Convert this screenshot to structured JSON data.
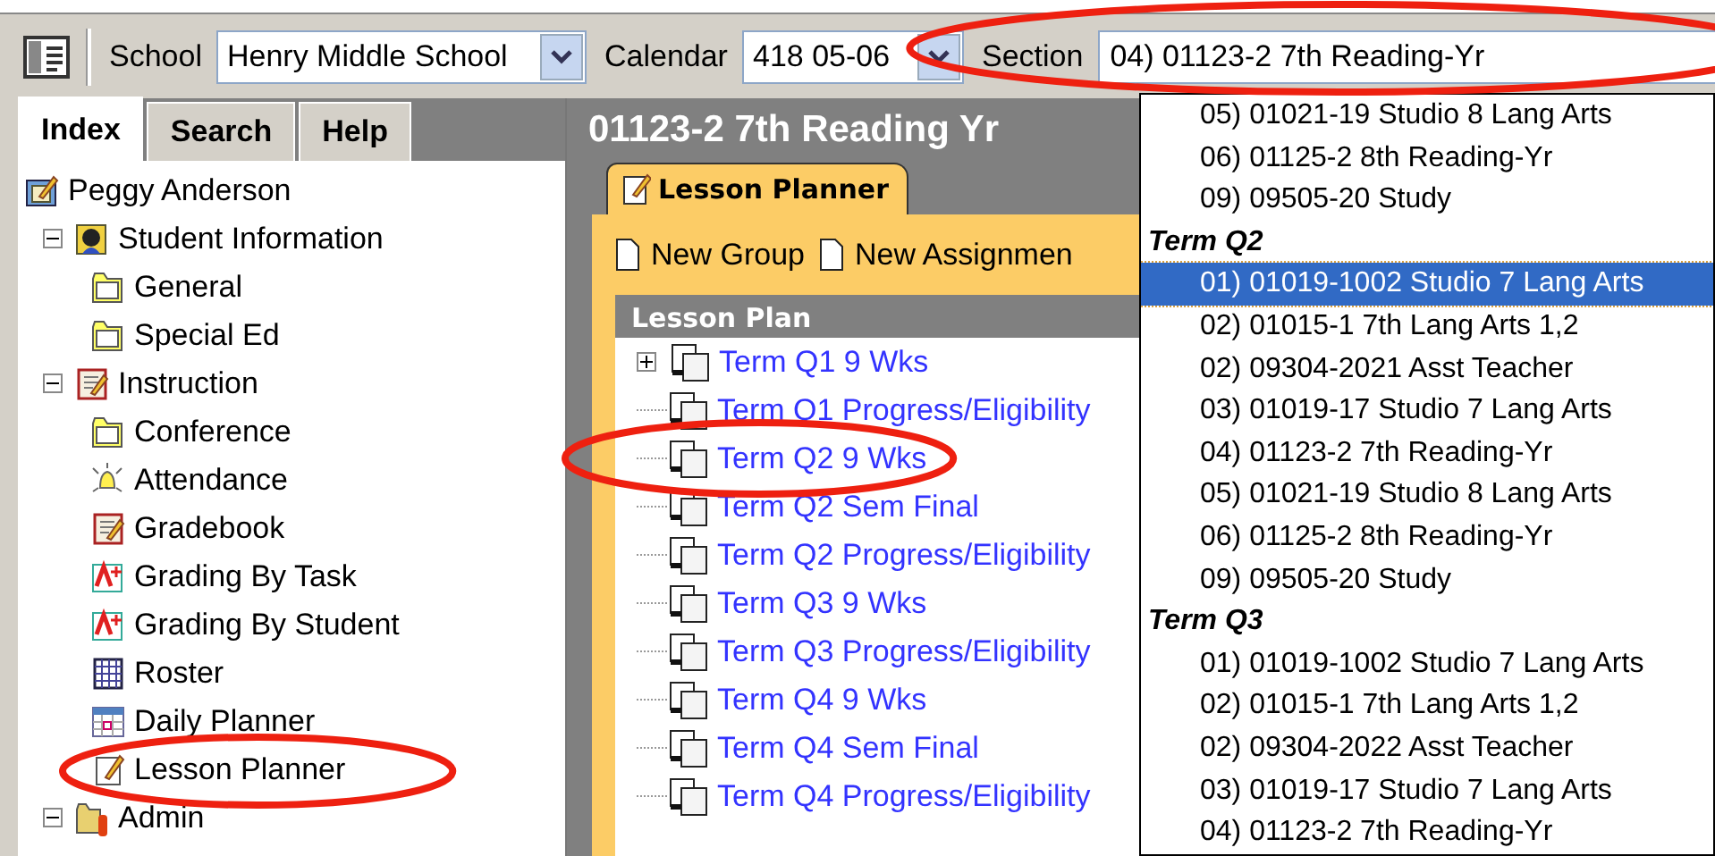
{
  "toolbar": {
    "school_label": "School",
    "school": "Henry Middle School",
    "calendar_label": "Calendar",
    "calendar": "418 05-06",
    "section_label": "Section",
    "section": "04) 01123-2 7th Reading-Yr",
    "section_circled": true
  },
  "sidebar": {
    "tabs": [
      {
        "label": "Index",
        "selected": true
      },
      {
        "label": "Search",
        "selected": false
      },
      {
        "label": "Help",
        "selected": false
      }
    ],
    "tree": [
      {
        "label": "Peggy Anderson",
        "kind": "person",
        "children": [
          {
            "label": "Student Information",
            "kind": "student",
            "expanded": true,
            "children": [
              {
                "label": "General",
                "kind": "folder"
              },
              {
                "label": "Special Ed",
                "kind": "folder"
              }
            ]
          },
          {
            "label": "Instruction",
            "kind": "notebook",
            "expanded": true,
            "children": [
              {
                "label": "Conference",
                "kind": "folder"
              },
              {
                "label": "Attendance",
                "kind": "bell"
              },
              {
                "label": "Gradebook",
                "kind": "notebook"
              },
              {
                "label": "Grading By Task",
                "kind": "grade"
              },
              {
                "label": "Grading By Student",
                "kind": "grade"
              },
              {
                "label": "Roster",
                "kind": "roster"
              },
              {
                "label": "Daily Planner",
                "kind": "calendar"
              },
              {
                "label": "Lesson Planner",
                "kind": "planner",
                "circled": true
              }
            ]
          },
          {
            "label": "Admin",
            "kind": "admin",
            "expanded": true
          }
        ]
      }
    ]
  },
  "main": {
    "title": "01123-2 7th Reading Yr",
    "tab": {
      "label": "Lesson Planner",
      "selected": true
    },
    "actions": [
      "New Group",
      "New Assignmen"
    ],
    "list_header": "Lesson Plan",
    "items": [
      {
        "label": "Term Q1 9 Wks",
        "expanded": false
      },
      {
        "label": "Term Q1 Progress/Eligibility"
      },
      {
        "label": "Term Q2 9 Wks",
        "circled": true
      },
      {
        "label": "Term Q2 Sem Final"
      },
      {
        "label": "Term Q2 Progress/Eligibility"
      },
      {
        "label": "Term Q3 9 Wks"
      },
      {
        "label": "Term Q3 Progress/Eligibility"
      },
      {
        "label": "Term Q4 9 Wks"
      },
      {
        "label": "Term Q4 Sem Final"
      },
      {
        "label": "Term Q4 Progress/Eligibility"
      }
    ]
  },
  "dropdown": [
    {
      "kind": "option",
      "label": "05) 01021-19 Studio 8 Lang Arts",
      "selected": false
    },
    {
      "kind": "option",
      "label": "06) 01125-2 8th Reading-Yr",
      "selected": false
    },
    {
      "kind": "option",
      "label": "09) 09505-20 Study",
      "selected": false
    },
    {
      "kind": "group",
      "label": "Term Q2"
    },
    {
      "kind": "option",
      "label": "01) 01019-1002 Studio 7 Lang Arts",
      "selected": true
    },
    {
      "kind": "option",
      "label": "02) 01015-1 7th Lang Arts 1,2",
      "selected": false
    },
    {
      "kind": "option",
      "label": "02) 09304-2021 Asst Teacher",
      "selected": false
    },
    {
      "kind": "option",
      "label": "03) 01019-17 Studio 7 Lang Arts",
      "selected": false
    },
    {
      "kind": "option",
      "label": "04) 01123-2 7th Reading-Yr",
      "selected": false
    },
    {
      "kind": "option",
      "label": "05) 01021-19 Studio 8 Lang Arts",
      "selected": false
    },
    {
      "kind": "option",
      "label": "06) 01125-2 8th Reading-Yr",
      "selected": false
    },
    {
      "kind": "option",
      "label": "09) 09505-20 Study",
      "selected": false
    },
    {
      "kind": "group",
      "label": "Term Q3"
    },
    {
      "kind": "option",
      "label": "01) 01019-1002 Studio 7 Lang Arts",
      "selected": false
    },
    {
      "kind": "option",
      "label": "02) 01015-1 7th Lang Arts 1,2",
      "selected": false
    },
    {
      "kind": "option",
      "label": "02) 09304-2022 Asst Teacher",
      "selected": false
    },
    {
      "kind": "option",
      "label": "03) 01019-17 Studio 7 Lang Arts",
      "selected": false
    },
    {
      "kind": "option",
      "label": "04) 01123-2 7th Reading-Yr",
      "selected": false
    }
  ]
}
